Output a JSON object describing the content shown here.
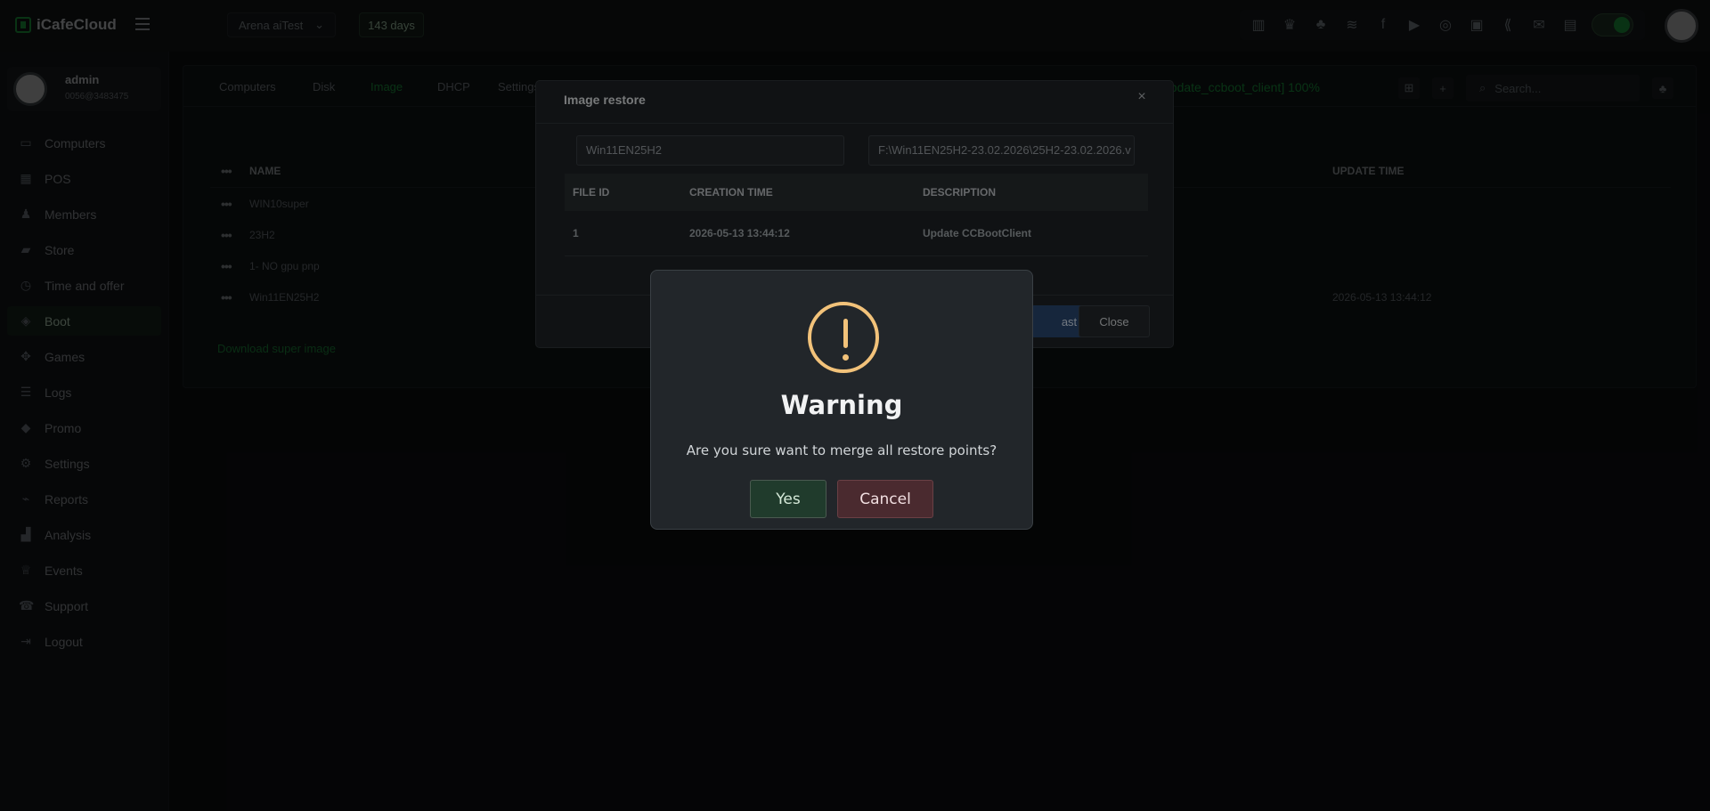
{
  "app": {
    "title": "iCafeCloud",
    "cafe_name": "Arena aiTest",
    "days_left": "143 days"
  },
  "profile": {
    "name": "admin",
    "id": "0056@3483475"
  },
  "sidebar": {
    "items": [
      {
        "label": "Computers",
        "icon": "monitor-icon"
      },
      {
        "label": "POS",
        "icon": "pos-icon"
      },
      {
        "label": "Members",
        "icon": "members-icon"
      },
      {
        "label": "Store",
        "icon": "store-icon"
      },
      {
        "label": "Time and offer",
        "icon": "clock-icon"
      },
      {
        "label": "Boot",
        "icon": "boot-icon"
      },
      {
        "label": "Games",
        "icon": "games-icon"
      },
      {
        "label": "Logs",
        "icon": "logs-icon"
      },
      {
        "label": "Promo",
        "icon": "tag-icon"
      },
      {
        "label": "Settings",
        "icon": "gear-icon"
      },
      {
        "label": "Reports",
        "icon": "reports-icon"
      },
      {
        "label": "Analysis",
        "icon": "analysis-icon"
      },
      {
        "label": "Events",
        "icon": "events-icon"
      },
      {
        "label": "Support",
        "icon": "phone-icon"
      },
      {
        "label": "Logout",
        "icon": "logout-icon"
      }
    ]
  },
  "content": {
    "tabs": [
      "Computers",
      "Disk",
      "Image",
      "DHCP",
      "Settings"
    ],
    "progress_text": "update_ccboot_client] 100%",
    "search_placeholder": "Search...",
    "table": {
      "headers": [
        "NAME",
        "UPDATE TIME"
      ],
      "rows": [
        {
          "name": "WIN10super",
          "update_time": ""
        },
        {
          "name": "23H2",
          "update_time": ""
        },
        {
          "name": "1- NO gpu pnp",
          "update_time": ""
        },
        {
          "name": "Win11EN25H2",
          "update_time": "2026-05-13 13:44:12"
        }
      ]
    },
    "download_link": "Download super image"
  },
  "image_restore": {
    "title": "Image restore",
    "image_name": "Win11EN25H2",
    "image_path": "F:\\Win11EN25H2-23.02.2026\\25H2-23.02.2026.v",
    "headers": [
      "FILE ID",
      "CREATION TIME",
      "DESCRIPTION"
    ],
    "rows": [
      {
        "file_id": "1",
        "creation_time": "2026-05-13 13:44:12",
        "description": "Update CCBootClient"
      }
    ],
    "last_label": "ast",
    "close_label": "Close"
  },
  "warning": {
    "title": "Warning",
    "message": "Are you sure want to merge all restore points?",
    "yes_label": "Yes",
    "cancel_label": "Cancel"
  }
}
